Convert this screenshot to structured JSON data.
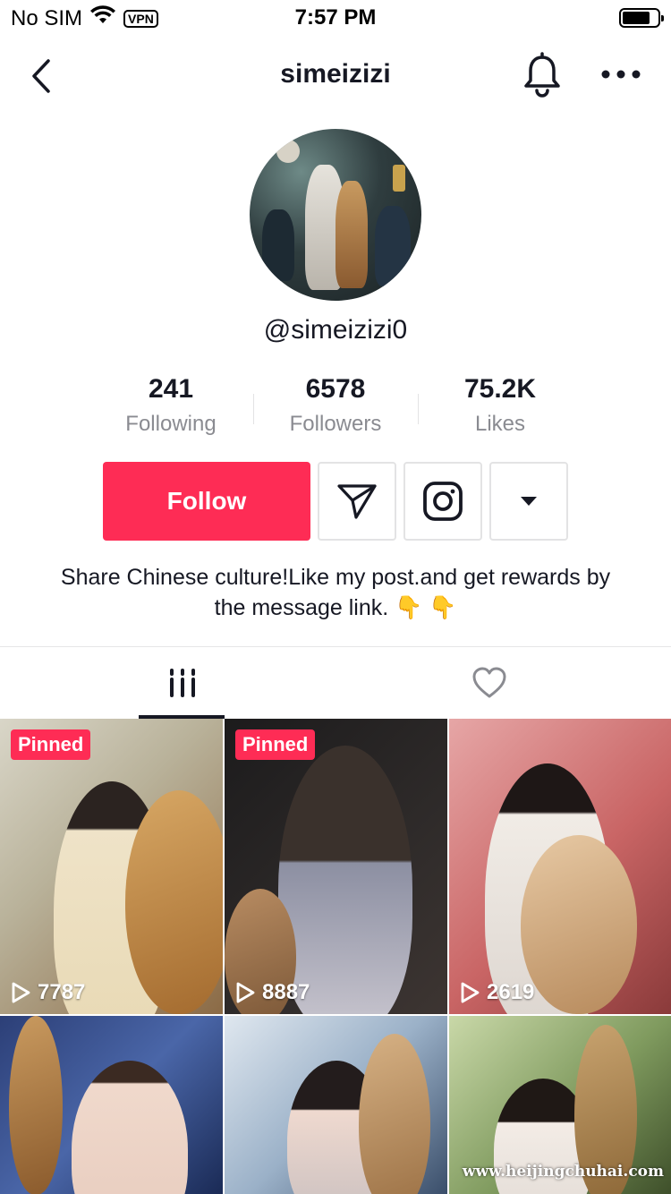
{
  "status_bar": {
    "carrier": "No SIM",
    "vpn": "VPN",
    "time": "7:57 PM"
  },
  "nav": {
    "title": "simeizizi"
  },
  "profile": {
    "handle": "@simeizizi0",
    "stats": [
      {
        "value": "241",
        "label": "Following"
      },
      {
        "value": "6578",
        "label": "Followers"
      },
      {
        "value": "75.2K",
        "label": "Likes"
      }
    ],
    "follow_label": "Follow",
    "bio": "Share Chinese culture!Like my post.and get rewards by the message link. 👇 👇"
  },
  "tabs": [
    {
      "name": "videos-tab",
      "icon": "grid-icon",
      "active": true
    },
    {
      "name": "liked-tab",
      "icon": "heart-icon",
      "active": false
    }
  ],
  "videos": [
    {
      "pinned_label": "Pinned",
      "views": "7787"
    },
    {
      "pinned_label": "Pinned",
      "views": "8887"
    },
    {
      "pinned_label": "",
      "views": "2619"
    },
    {
      "pinned_label": "",
      "views": ""
    },
    {
      "pinned_label": "",
      "views": ""
    },
    {
      "pinned_label": "",
      "views": ""
    }
  ],
  "watermark": "www.heijingchuhai.com",
  "colors": {
    "accent": "#fe2c55",
    "text": "#161823",
    "muted": "#8a8b91"
  }
}
